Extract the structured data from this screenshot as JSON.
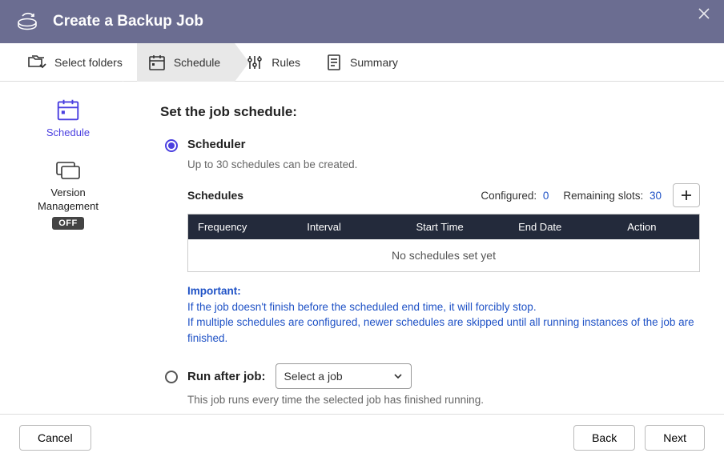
{
  "titlebar": {
    "title": "Create a Backup Job"
  },
  "steps": {
    "select_folders": "Select folders",
    "schedule": "Schedule",
    "rules": "Rules",
    "summary": "Summary"
  },
  "sidebar": {
    "schedule_label": "Schedule",
    "version_mgmt_line1": "Version",
    "version_mgmt_line2": "Management",
    "version_mgmt_badge": "OFF"
  },
  "schedule": {
    "heading": "Set the job schedule:",
    "scheduler": {
      "title": "Scheduler",
      "desc": "Up to 30 schedules can be created.",
      "list_label": "Schedules",
      "configured_label": "Configured:",
      "configured_value": "0",
      "remaining_label": "Remaining slots:",
      "remaining_value": "30",
      "cols": {
        "c1": "Frequency",
        "c2": "Interval",
        "c3": "Start Time",
        "c4": "End Date",
        "c5": "Action"
      },
      "empty_text": "No schedules set yet",
      "important_title": "Important:",
      "important_l1": "If the job doesn't finish before the scheduled end time, it will forcibly stop.",
      "important_l2": "If multiple schedules are configured, newer schedules are skipped until all running instances of the job are finished."
    },
    "run_after": {
      "title": "Run after job:",
      "select_placeholder": "Select a job",
      "desc": "This job runs every time the selected job has finished running."
    }
  },
  "footer": {
    "cancel": "Cancel",
    "back": "Back",
    "next": "Next"
  }
}
